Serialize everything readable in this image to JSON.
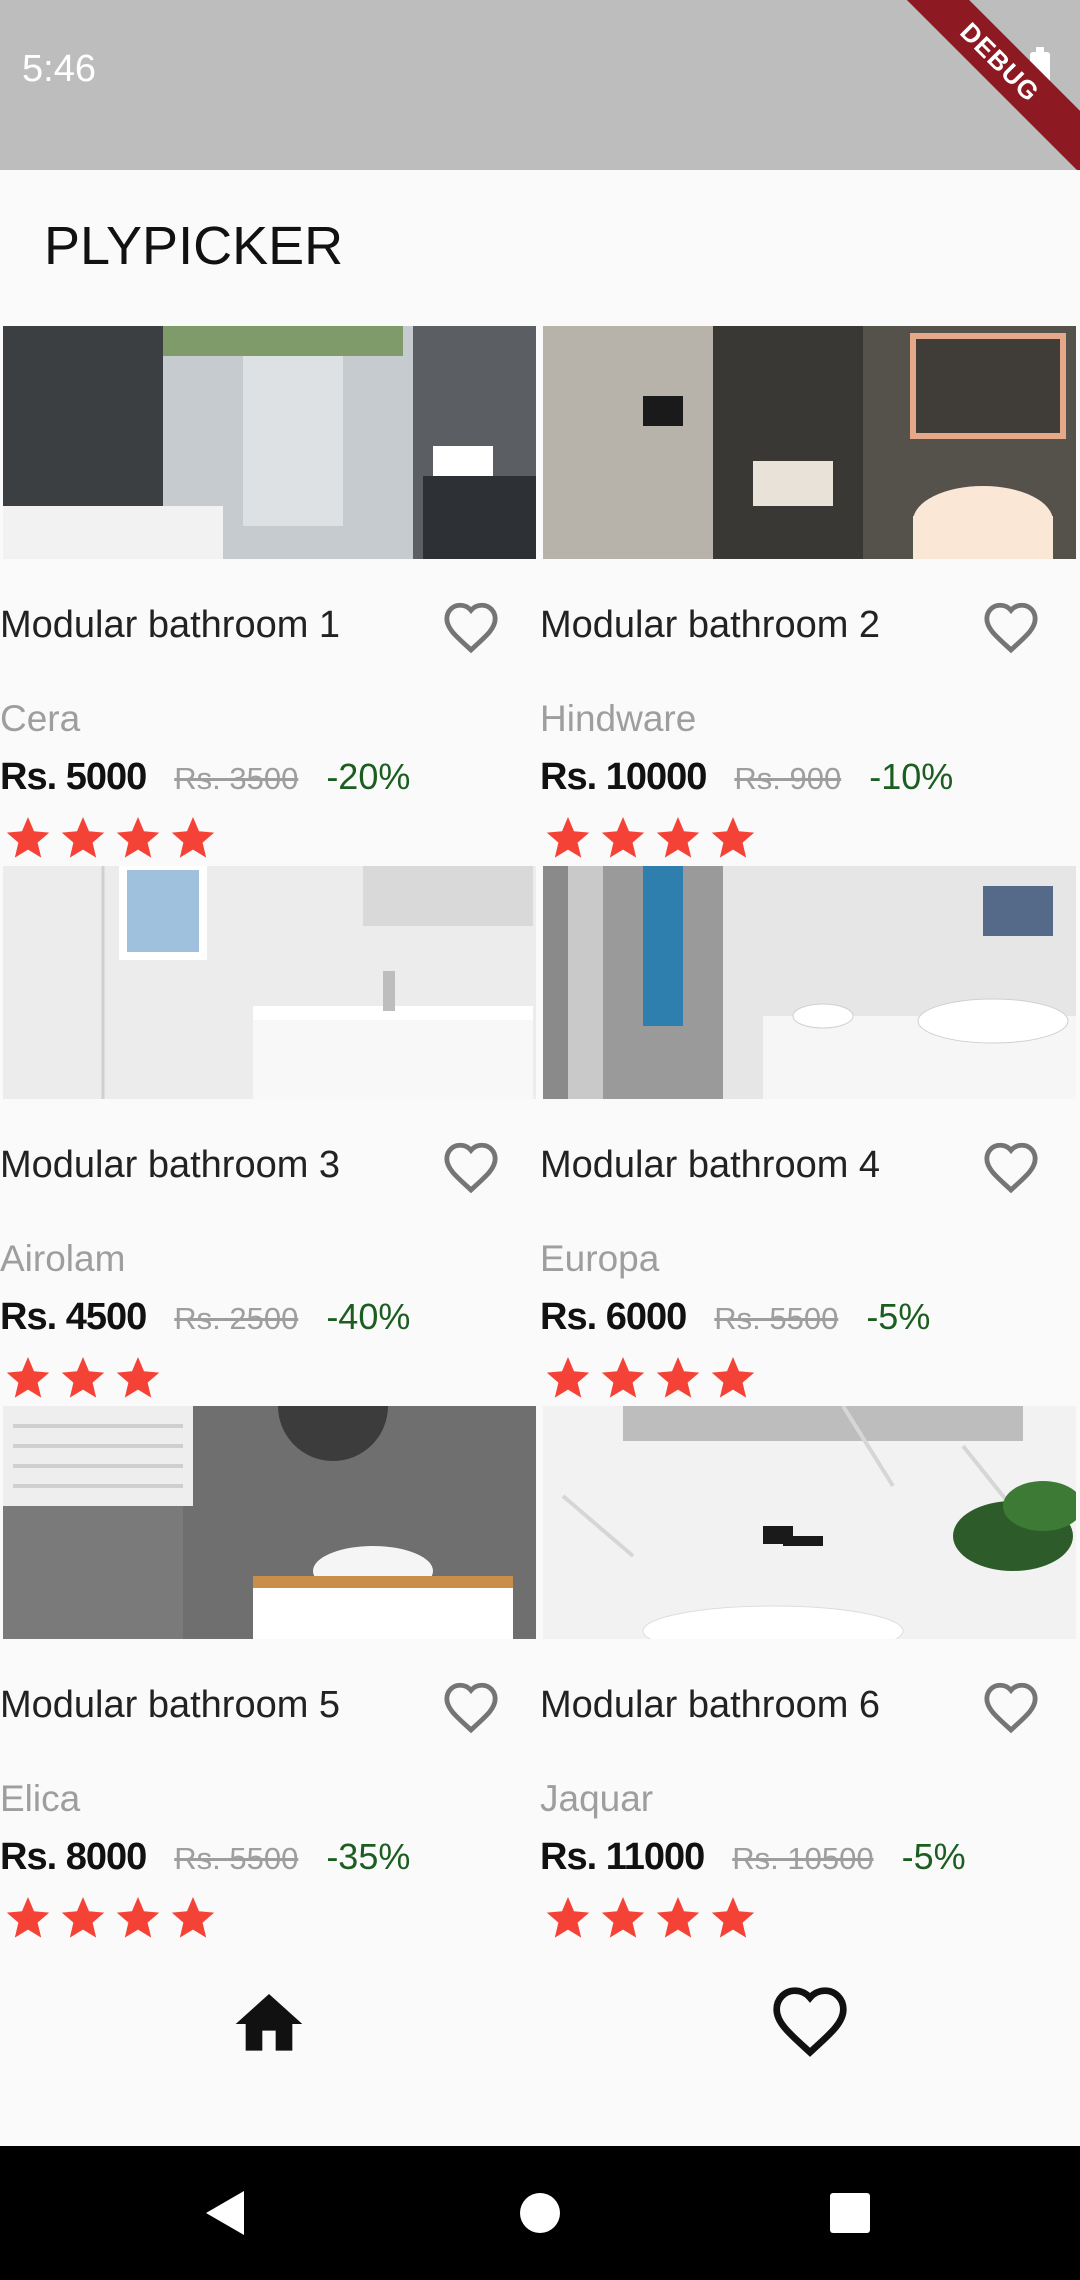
{
  "status_bar": {
    "time": "5:46",
    "debug_label": "DEBUG"
  },
  "app_bar": {
    "title": "PLYPICKER"
  },
  "colors": {
    "star": "#f44336",
    "discount": "#1b5e20",
    "muted": "#9e9e9e",
    "status_bar": "#bdbdbd",
    "debug_ribbon": "#8d1a22"
  },
  "products": [
    {
      "title": "Modular bathroom 1",
      "brand": "Cera",
      "price": "Rs. 5000",
      "old_price": "Rs. 3500",
      "discount": "-20%",
      "rating": 4,
      "image": "bathroom-dark-tiles-image",
      "favorite_icon": "heart-outline-icon"
    },
    {
      "title": "Modular bathroom 2",
      "brand": "Hindware",
      "price": "Rs. 10000",
      "old_price": "Rs. 900",
      "discount": "-10%",
      "rating": 4,
      "image": "bathroom-dark-stone-image",
      "favorite_icon": "heart-outline-icon"
    },
    {
      "title": "Modular bathroom 3",
      "brand": "Airolam",
      "price": "Rs. 4500",
      "old_price": "Rs. 2500",
      "discount": "-40%",
      "rating": 3,
      "image": "bathroom-white-tiles-image",
      "favorite_icon": "heart-outline-icon"
    },
    {
      "title": "Modular bathroom 4",
      "brand": "Europa",
      "price": "Rs. 6000",
      "old_price": "Rs. 5500",
      "discount": "-5%",
      "rating": 4,
      "image": "bathroom-double-sink-image",
      "favorite_icon": "heart-outline-icon"
    },
    {
      "title": "Modular bathroom 5",
      "brand": "Elica",
      "price": "Rs. 8000",
      "old_price": "Rs. 5500",
      "discount": "-35%",
      "rating": 4,
      "image": "bathroom-grey-tiles-image",
      "favorite_icon": "heart-outline-icon"
    },
    {
      "title": "Modular bathroom 6",
      "brand": "Jaquar",
      "price": "Rs. 11000",
      "old_price": "Rs. 10500",
      "discount": "-5%",
      "rating": 4,
      "image": "bathroom-marble-image",
      "favorite_icon": "heart-outline-icon"
    }
  ],
  "bottom_nav": [
    {
      "name": "home",
      "icon": "home-icon"
    },
    {
      "name": "favorites",
      "icon": "heart-outline-icon"
    }
  ],
  "system_nav": [
    {
      "name": "back",
      "icon": "back-triangle-icon"
    },
    {
      "name": "home",
      "icon": "home-circle-icon"
    },
    {
      "name": "recents",
      "icon": "recents-square-icon"
    }
  ]
}
